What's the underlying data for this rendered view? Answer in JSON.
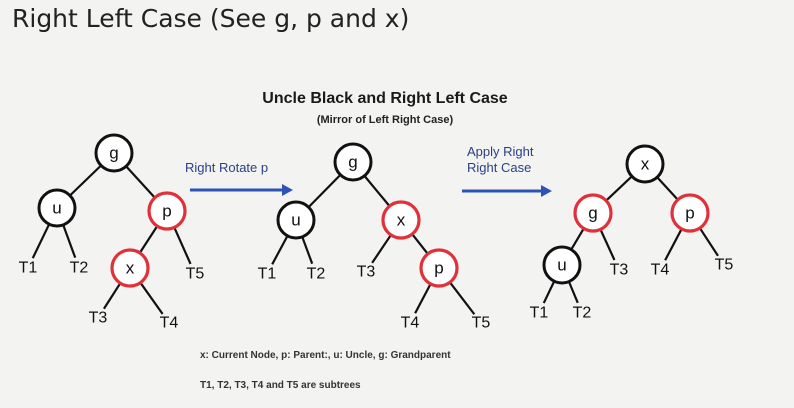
{
  "slide": {
    "heading": "Right Left Case (See g, p and x)",
    "subheading": "Uncle Black and Right Left Case",
    "subsubheading": "(Mirror of Left Right Case)",
    "legend_line1": "x: Current Node, p: Parent:, u: Uncle, g: Grandparent",
    "legend_line2": "T1, T2, T3, T4 and T5 are subtrees"
  },
  "colors": {
    "black_node": "#111111",
    "red_node": "#e0303a",
    "arrow": "#2e53b7"
  },
  "arrows": [
    {
      "label_lines": [
        "Right Rotate p"
      ]
    },
    {
      "label_lines": [
        "Apply Right",
        "Right Case"
      ]
    }
  ],
  "trees": [
    {
      "nodes": [
        {
          "id": "g",
          "label": "g",
          "color": "black"
        },
        {
          "id": "u",
          "label": "u",
          "color": "black"
        },
        {
          "id": "p",
          "label": "p",
          "color": "red"
        },
        {
          "id": "x",
          "label": "x",
          "color": "red"
        }
      ],
      "subtrees": [
        "T1",
        "T2",
        "T3",
        "T4",
        "T5"
      ]
    },
    {
      "nodes": [
        {
          "id": "g",
          "label": "g",
          "color": "black"
        },
        {
          "id": "u",
          "label": "u",
          "color": "black"
        },
        {
          "id": "x",
          "label": "x",
          "color": "red"
        },
        {
          "id": "p",
          "label": "p",
          "color": "red"
        }
      ],
      "subtrees": [
        "T1",
        "T2",
        "T3",
        "T4",
        "T5"
      ]
    },
    {
      "nodes": [
        {
          "id": "x",
          "label": "x",
          "color": "black"
        },
        {
          "id": "g",
          "label": "g",
          "color": "red"
        },
        {
          "id": "p",
          "label": "p",
          "color": "red"
        },
        {
          "id": "u",
          "label": "u",
          "color": "black"
        }
      ],
      "subtrees": [
        "T1",
        "T2",
        "T3",
        "T4",
        "T5"
      ]
    }
  ]
}
